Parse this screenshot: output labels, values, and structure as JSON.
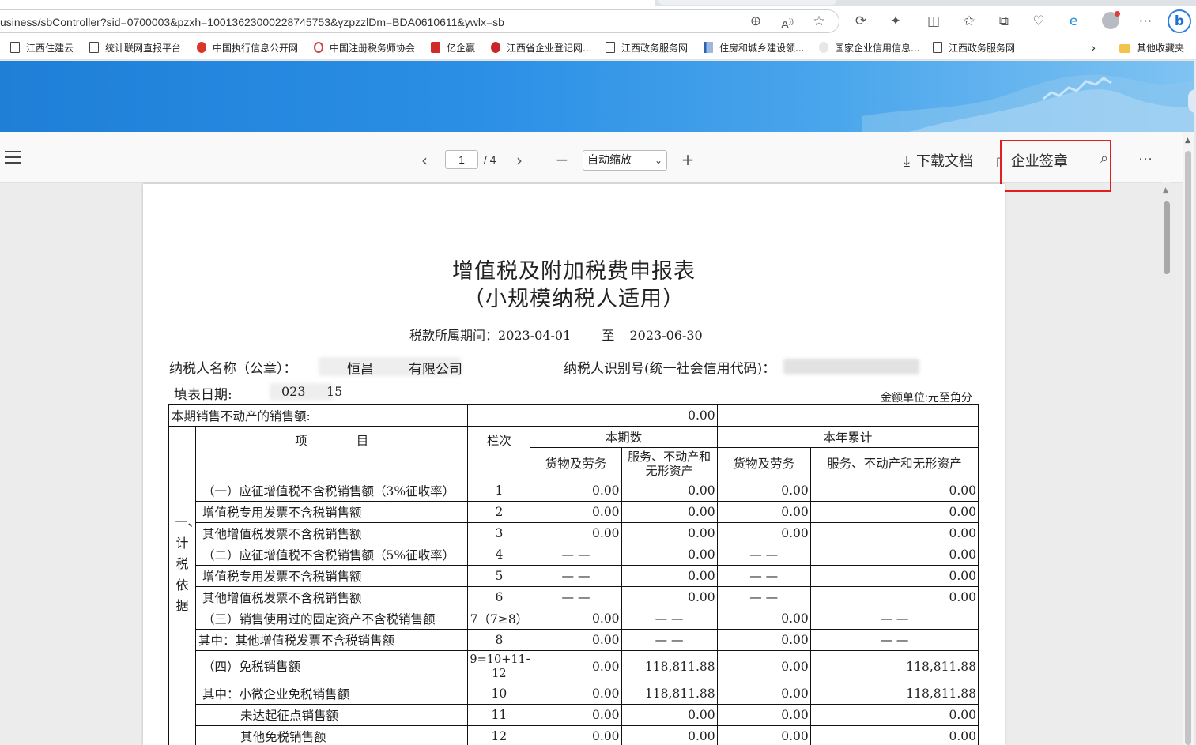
{
  "browser": {
    "url": "usiness/sbController?sid=0700003&pzxh=10013623000228745753&yzpzzlDm=BDA0610611&ywlx=sb",
    "bookmarks": [
      {
        "label": "江西住建云",
        "icon": "page-icon"
      },
      {
        "label": "统计联网直报平台",
        "icon": "page-icon"
      },
      {
        "label": "中国执行信息公开网",
        "icon": "emblem-icon"
      },
      {
        "label": "中国注册税务师协会",
        "icon": "circle-logo-icon"
      },
      {
        "label": "亿企赢",
        "icon": "red-logo-icon"
      },
      {
        "label": "江西省企业登记网...",
        "icon": "emblem-icon"
      },
      {
        "label": "江西政务服务网",
        "icon": "page-icon"
      },
      {
        "label": "住房和城乡建设领...",
        "icon": "site-logo-icon"
      },
      {
        "label": "国家企业信用信息...",
        "icon": "faded-logo-icon"
      },
      {
        "label": "江西政务服务网",
        "icon": "page-icon"
      }
    ],
    "other_bookmarks": "其他收藏夹"
  },
  "viewer": {
    "page_current": "1",
    "page_total": "/ 4",
    "zoom": "自动缩放",
    "download_label": "下载文档",
    "seal_label": "企业签章",
    "highlight_color": "#e02020"
  },
  "document": {
    "title": "增值税及附加税费申报表",
    "subtitle": "（小规模纳税人适用）",
    "period_label": "税款所属期间：",
    "period_start": "2023-04-01",
    "period_to": "至",
    "period_end": "2023-06-30",
    "taxpayer_name_label": "纳税人名称（公章）：",
    "taxpayer_name_visible": "恒昌",
    "taxpayer_name_visible2": "有限公司",
    "taxpayer_id_label": "纳税人识别号(统一社会信用代码)：",
    "fill_date_label": "填表日期:",
    "fill_date_visible": "023",
    "fill_date_visible2": "15",
    "unit_label": "金额单位:元至角分",
    "table": {
      "real_estate_label": "本期销售不动产的销售额:",
      "real_estate_value": "0.00",
      "header_item": "项　　　　目",
      "header_col": "栏次",
      "header_current": "本期数",
      "header_ytd": "本年累计",
      "sub_goods": "货物及劳务",
      "sub_services": "服务、不动产和无形资产",
      "sub_services_short": "服务、不动产和\n无形资产",
      "section_label": "一、计税依据",
      "rows": [
        {
          "item": "（一）应征增值税不含税销售额（3%征收率）",
          "col": "1",
          "c1": "0.00",
          "c2": "0.00",
          "y1": "0.00",
          "y2": "0.00"
        },
        {
          "item": "增值税专用发票不含税销售额",
          "col": "2",
          "c1": "0.00",
          "c2": "0.00",
          "y1": "0.00",
          "y2": "0.00"
        },
        {
          "item": "其他增值税发票不含税销售额",
          "col": "3",
          "c1": "0.00",
          "c2": "0.00",
          "y1": "0.00",
          "y2": "0.00"
        },
        {
          "item": "（二）应征增值税不含税销售额（5%征收率）",
          "col": "4",
          "c1": "— —",
          "c2": "0.00",
          "y1": "— —",
          "y2": "0.00"
        },
        {
          "item": "增值税专用发票不含税销售额",
          "col": "5",
          "c1": "— —",
          "c2": "0.00",
          "y1": "— —",
          "y2": "0.00"
        },
        {
          "item": "其他增值税发票不含税销售额",
          "col": "6",
          "c1": "— —",
          "c2": "0.00",
          "y1": "— —",
          "y2": "0.00"
        },
        {
          "item": "（三）销售使用过的固定资产不含税销售额",
          "col": "7（7≥8）",
          "c1": "0.00",
          "c2": "— —",
          "y1": "0.00",
          "y2": "— —"
        },
        {
          "item": "其中：其他增值税发票不含税销售额",
          "col": "8",
          "c1": "0.00",
          "c2": "— —",
          "y1": "0.00",
          "y2": "— —"
        },
        {
          "item": "（四）免税销售额",
          "col": "9=10+11+\n12",
          "c1": "0.00",
          "c2": "118,811.88",
          "y1": "0.00",
          "y2": "118,811.88"
        },
        {
          "item": "其中：小微企业免税销售额",
          "col": "10",
          "c1": "0.00",
          "c2": "118,811.88",
          "y1": "0.00",
          "y2": "118,811.88"
        },
        {
          "item": "未达起征点销售额",
          "col": "11",
          "c1": "0.00",
          "c2": "0.00",
          "y1": "0.00",
          "y2": "0.00"
        },
        {
          "item": "其他免税销售额",
          "col": "12",
          "c1": "0.00",
          "c2": "0.00",
          "y1": "0.00",
          "y2": "0.00"
        }
      ]
    }
  }
}
